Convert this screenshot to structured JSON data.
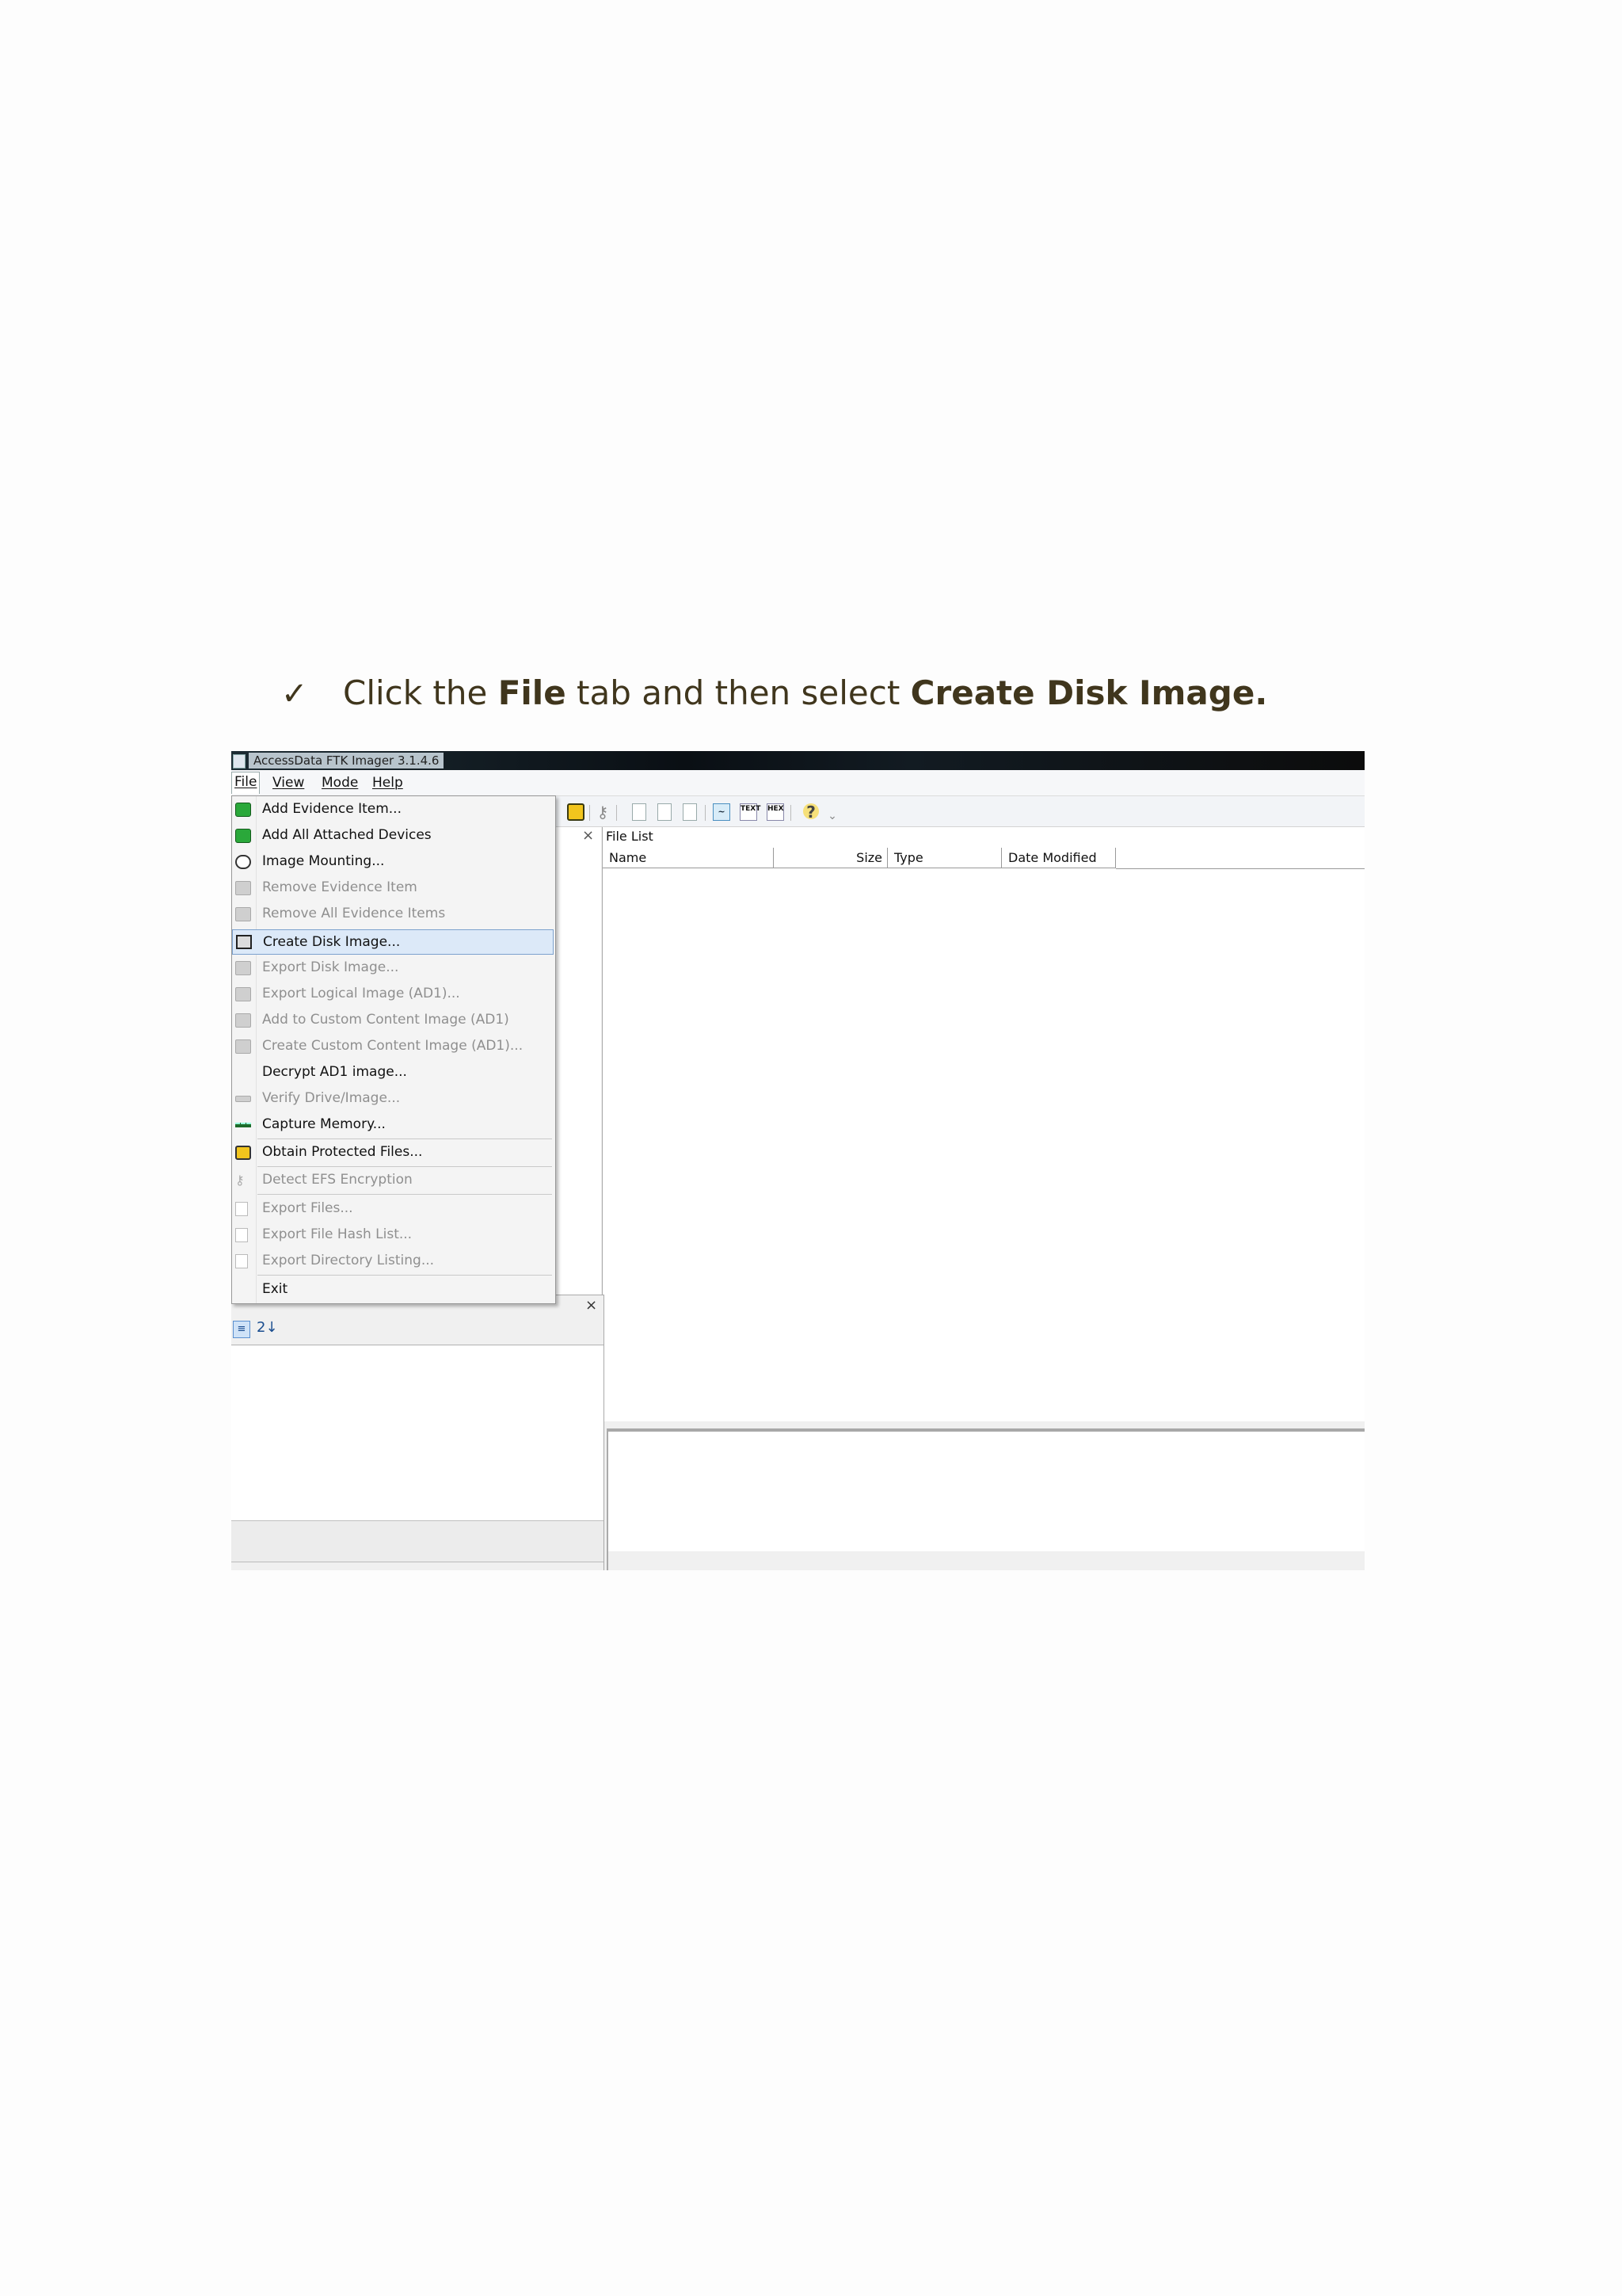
{
  "instruction": {
    "prefix": "Click the ",
    "bold1": "File",
    "middle": " tab and then select ",
    "bold2": "Create Disk Image."
  },
  "app": {
    "title": "AccessData FTK Imager 3.1.4.6"
  },
  "menubar": {
    "file": "File",
    "view": "View",
    "mode": "Mode",
    "help": "Help"
  },
  "file_menu": [
    {
      "label": "Add Evidence Item...",
      "enabled": true,
      "icon": "add-evidence-icon"
    },
    {
      "label": "Add All Attached Devices",
      "enabled": true,
      "icon": "add-devices-icon"
    },
    {
      "label": "Image Mounting...",
      "enabled": true,
      "icon": "image-mounting-icon"
    },
    {
      "label": "Remove Evidence Item",
      "enabled": false,
      "icon": "remove-evidence-icon"
    },
    {
      "label": "Remove All Evidence Items",
      "enabled": false,
      "icon": "remove-all-evidence-icon"
    },
    {
      "label": "Create Disk Image...",
      "enabled": true,
      "highlighted": true,
      "icon": "create-disk-image-icon"
    },
    {
      "label": "Export Disk Image...",
      "enabled": false,
      "icon": "export-disk-image-icon"
    },
    {
      "label": "Export Logical Image (AD1)...",
      "enabled": false,
      "icon": "export-logical-image-icon"
    },
    {
      "label": "Add to Custom Content Image (AD1)",
      "enabled": false,
      "icon": "add-custom-content-icon"
    },
    {
      "label": "Create Custom Content Image (AD1)...",
      "enabled": false,
      "icon": "create-custom-content-icon"
    },
    {
      "label": "Decrypt AD1 image...",
      "enabled": true,
      "icon": ""
    },
    {
      "label": "Verify Drive/Image...",
      "enabled": false,
      "icon": "verify-drive-icon"
    },
    {
      "label": "Capture Memory...",
      "enabled": true,
      "icon": "capture-memory-icon"
    },
    {
      "label": "Obtain Protected Files...",
      "enabled": true,
      "icon": "obtain-protected-files-icon"
    },
    {
      "label": "Detect EFS Encryption",
      "enabled": false,
      "icon": "detect-efs-icon"
    },
    {
      "label": "Export Files...",
      "enabled": false,
      "icon": "export-files-icon"
    },
    {
      "label": "Export File Hash List...",
      "enabled": false,
      "icon": "export-hash-list-icon"
    },
    {
      "label": "Export Directory Listing...",
      "enabled": false,
      "icon": "export-directory-icon"
    },
    {
      "label": "Exit",
      "enabled": true,
      "icon": ""
    }
  ],
  "file_list": {
    "title": "File List",
    "columns": [
      "Name",
      "Size",
      "Type",
      "Date Modified"
    ]
  },
  "toolbar": {
    "text_button": "TEXT",
    "hex_button": "HEX"
  },
  "properties": {
    "close": "×",
    "sort_icon_label": "2↓"
  },
  "evidence_tree": {
    "close": "×"
  },
  "colors": {
    "text": "#40361d",
    "menu_highlight": "#dce9f8",
    "menu_highlight_border": "#7da2ce",
    "disabled_text": "#8f8f8f"
  }
}
